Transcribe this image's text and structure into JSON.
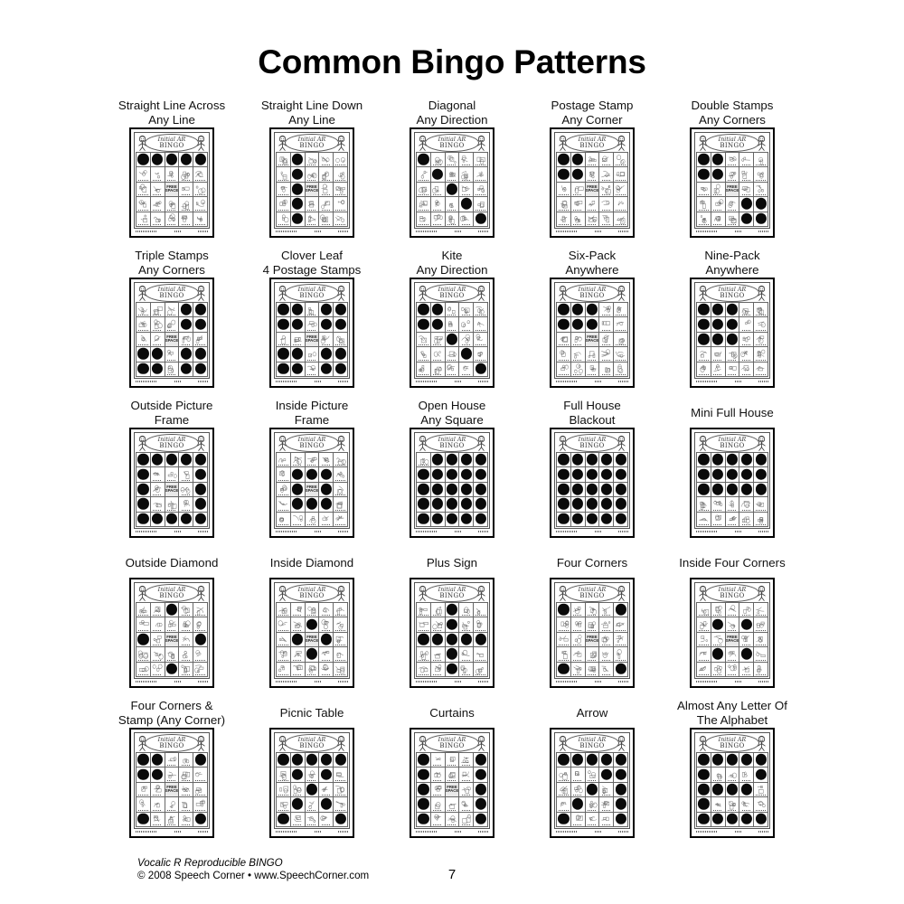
{
  "document": {
    "title": "Common Bingo Patterns",
    "page_number": "7"
  },
  "footer": {
    "line1": "Vocalic R Reproducible BINGO",
    "line2": "© 2008 Speech Corner • www.SpeechCorner.com"
  },
  "card": {
    "banner_line1": "Initial AR",
    "banner_line2": "BINGO",
    "free_space": "FREE SPACE"
  },
  "colors": {
    "ink": "#000000",
    "dot": "#0a0a0a",
    "free_bg": "#e9e9e9",
    "paper": "#ffffff"
  },
  "patterns": [
    {
      "label": "Straight Line Across\nAny Line",
      "cells": [
        1,
        1,
        1,
        1,
        1,
        0,
        0,
        0,
        0,
        0,
        0,
        0,
        0,
        0,
        0,
        0,
        0,
        0,
        0,
        0,
        0,
        0,
        0,
        0,
        0
      ]
    },
    {
      "label": "Straight Line Down\nAny Line",
      "cells": [
        0,
        1,
        0,
        0,
        0,
        0,
        1,
        0,
        0,
        0,
        0,
        1,
        0,
        0,
        0,
        0,
        1,
        0,
        0,
        0,
        0,
        1,
        0,
        0,
        0
      ]
    },
    {
      "label": "Diagonal\nAny Direction",
      "cells": [
        1,
        0,
        0,
        0,
        0,
        0,
        1,
        0,
        0,
        0,
        0,
        0,
        1,
        0,
        0,
        0,
        0,
        0,
        1,
        0,
        0,
        0,
        0,
        0,
        1
      ]
    },
    {
      "label": "Postage Stamp\nAny Corner",
      "cells": [
        1,
        1,
        0,
        0,
        0,
        1,
        1,
        0,
        0,
        0,
        0,
        0,
        0,
        0,
        0,
        0,
        0,
        0,
        0,
        0,
        0,
        0,
        0,
        0,
        0
      ]
    },
    {
      "label": "Double Stamps\nAny Corners",
      "cells": [
        1,
        1,
        0,
        0,
        0,
        1,
        1,
        0,
        0,
        0,
        0,
        0,
        0,
        0,
        0,
        0,
        0,
        0,
        1,
        1,
        0,
        0,
        0,
        1,
        1
      ]
    },
    {
      "label": "Triple Stamps\nAny Corners",
      "cells": [
        0,
        0,
        0,
        1,
        1,
        0,
        0,
        0,
        1,
        1,
        0,
        0,
        0,
        0,
        0,
        1,
        1,
        0,
        1,
        1,
        1,
        1,
        0,
        1,
        1
      ]
    },
    {
      "label": "Clover Leaf\n4 Postage Stamps",
      "cells": [
        1,
        1,
        0,
        1,
        1,
        1,
        1,
        0,
        1,
        1,
        0,
        0,
        0,
        0,
        0,
        1,
        1,
        0,
        1,
        1,
        1,
        1,
        0,
        1,
        1
      ]
    },
    {
      "label": "Kite\nAny Direction",
      "cells": [
        1,
        1,
        0,
        0,
        0,
        1,
        1,
        0,
        0,
        0,
        0,
        0,
        1,
        0,
        0,
        0,
        0,
        0,
        1,
        0,
        0,
        0,
        0,
        0,
        1
      ]
    },
    {
      "label": "Six-Pack\nAnywhere",
      "cells": [
        1,
        1,
        1,
        0,
        0,
        1,
        1,
        1,
        0,
        0,
        0,
        0,
        0,
        0,
        0,
        0,
        0,
        0,
        0,
        0,
        0,
        0,
        0,
        0,
        0
      ]
    },
    {
      "label": "Nine-Pack\nAnywhere",
      "cells": [
        1,
        1,
        1,
        0,
        0,
        1,
        1,
        1,
        0,
        0,
        1,
        1,
        1,
        0,
        0,
        0,
        0,
        0,
        0,
        0,
        0,
        0,
        0,
        0,
        0
      ]
    },
    {
      "label": "Outside Picture\nFrame",
      "cells": [
        1,
        1,
        1,
        1,
        1,
        1,
        0,
        0,
        0,
        1,
        1,
        0,
        0,
        0,
        1,
        1,
        0,
        0,
        0,
        1,
        1,
        1,
        1,
        1,
        1
      ]
    },
    {
      "label": "Inside Picture\nFrame",
      "cells": [
        0,
        0,
        0,
        0,
        0,
        0,
        1,
        1,
        1,
        0,
        0,
        1,
        0,
        1,
        0,
        0,
        1,
        1,
        1,
        0,
        0,
        0,
        0,
        0,
        0
      ]
    },
    {
      "label": "Open House\nAny Square",
      "cells": [
        0,
        1,
        1,
        1,
        1,
        1,
        1,
        1,
        1,
        1,
        1,
        1,
        1,
        1,
        1,
        1,
        1,
        1,
        1,
        1,
        1,
        1,
        1,
        1,
        1
      ]
    },
    {
      "label": "Full House\nBlackout",
      "cells": [
        1,
        1,
        1,
        1,
        1,
        1,
        1,
        1,
        1,
        1,
        1,
        1,
        1,
        1,
        1,
        1,
        1,
        1,
        1,
        1,
        1,
        1,
        1,
        1,
        1
      ]
    },
    {
      "label": "Mini Full House",
      "cells": [
        1,
        1,
        1,
        1,
        1,
        1,
        1,
        1,
        1,
        1,
        1,
        1,
        1,
        1,
        1,
        0,
        0,
        0,
        0,
        0,
        0,
        0,
        0,
        0,
        0
      ]
    },
    {
      "label": "Outside Diamond",
      "cells": [
        0,
        0,
        1,
        0,
        0,
        0,
        0,
        0,
        0,
        0,
        1,
        0,
        0,
        0,
        1,
        0,
        0,
        0,
        0,
        0,
        0,
        0,
        1,
        0,
        0
      ]
    },
    {
      "label": "Inside Diamond",
      "cells": [
        0,
        0,
        0,
        0,
        0,
        0,
        0,
        1,
        0,
        0,
        0,
        1,
        0,
        1,
        0,
        0,
        0,
        1,
        0,
        0,
        0,
        0,
        0,
        0,
        0
      ]
    },
    {
      "label": "Plus Sign",
      "cells": [
        0,
        0,
        1,
        0,
        0,
        0,
        0,
        1,
        0,
        0,
        1,
        1,
        1,
        1,
        1,
        0,
        0,
        1,
        0,
        0,
        0,
        0,
        1,
        0,
        0
      ]
    },
    {
      "label": "Four Corners",
      "cells": [
        1,
        0,
        0,
        0,
        1,
        0,
        0,
        0,
        0,
        0,
        0,
        0,
        0,
        0,
        0,
        0,
        0,
        0,
        0,
        0,
        1,
        0,
        0,
        0,
        1
      ]
    },
    {
      "label": "Inside Four Corners",
      "cells": [
        0,
        0,
        0,
        0,
        0,
        0,
        1,
        0,
        1,
        0,
        0,
        0,
        0,
        0,
        0,
        0,
        1,
        0,
        1,
        0,
        0,
        0,
        0,
        0,
        0
      ]
    },
    {
      "label": "Four Corners &\nStamp (Any Corner)",
      "cells": [
        1,
        1,
        0,
        0,
        1,
        1,
        1,
        0,
        0,
        0,
        0,
        0,
        0,
        0,
        0,
        0,
        0,
        0,
        0,
        0,
        1,
        0,
        0,
        0,
        1
      ]
    },
    {
      "label": "Picnic Table",
      "cells": [
        1,
        1,
        1,
        1,
        1,
        0,
        1,
        0,
        1,
        0,
        0,
        0,
        1,
        0,
        0,
        0,
        1,
        0,
        1,
        0,
        1,
        0,
        0,
        0,
        1
      ]
    },
    {
      "label": "Curtains",
      "cells": [
        1,
        0,
        0,
        0,
        1,
        1,
        0,
        0,
        0,
        1,
        1,
        0,
        0,
        0,
        1,
        1,
        0,
        0,
        0,
        1,
        1,
        0,
        0,
        0,
        1
      ]
    },
    {
      "label": "Arrow",
      "cells": [
        1,
        1,
        1,
        1,
        1,
        0,
        0,
        0,
        1,
        1,
        0,
        0,
        1,
        0,
        1,
        0,
        1,
        0,
        0,
        1,
        1,
        0,
        0,
        0,
        1
      ]
    },
    {
      "label": "Almost Any Letter Of\nThe Alphabet",
      "cells": [
        1,
        1,
        1,
        1,
        1,
        1,
        0,
        0,
        0,
        1,
        1,
        1,
        1,
        1,
        0,
        1,
        0,
        0,
        0,
        0,
        1,
        1,
        1,
        1,
        1
      ]
    }
  ]
}
